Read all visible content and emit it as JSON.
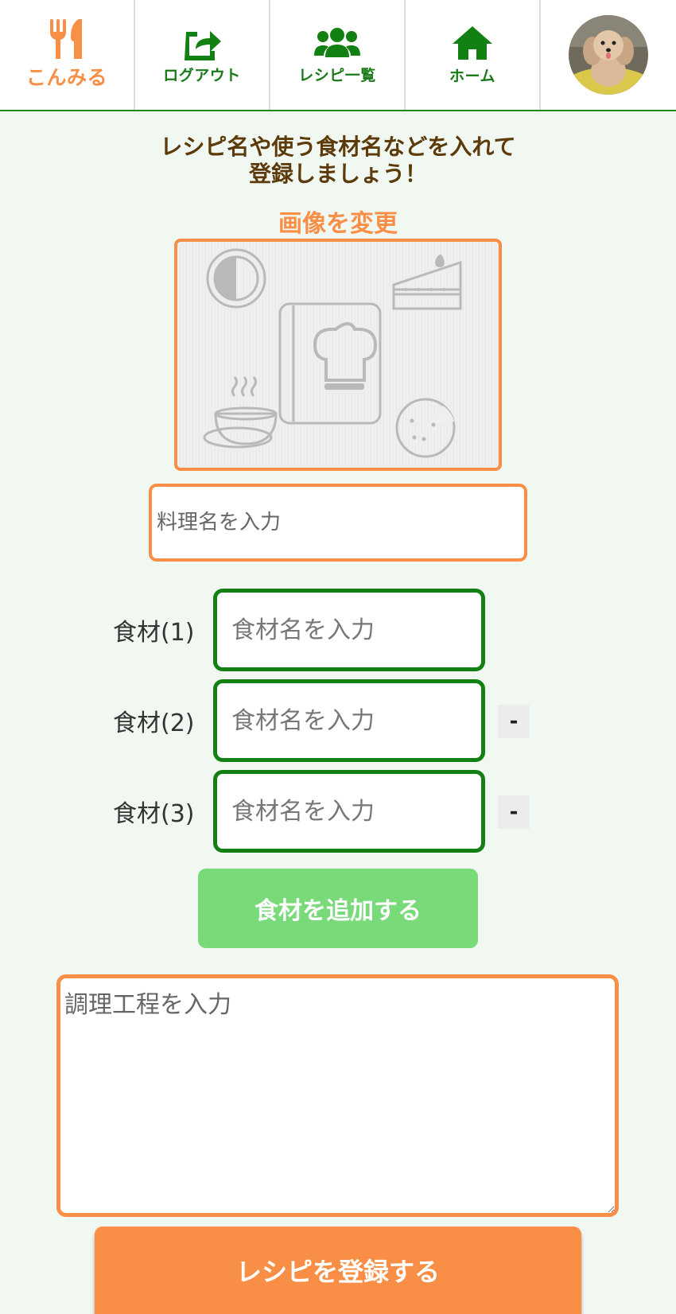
{
  "nav": {
    "brand": "こんみる",
    "logout": "ログアウト",
    "recipes": "レシピ一覧",
    "home": "ホーム"
  },
  "headline": {
    "line1": "レシピ名や使う食材名などを入れて",
    "line2": "登録しましょう！"
  },
  "image": {
    "change_label": "画像を変更"
  },
  "form": {
    "title_placeholder": "料理名を入力",
    "ingredients": [
      {
        "label": "食材(1)",
        "placeholder": "食材名を入力"
      },
      {
        "label": "食材(2)",
        "placeholder": "食材名を入力",
        "remove": "-"
      },
      {
        "label": "食材(3)",
        "placeholder": "食材名を入力",
        "remove": "-"
      }
    ],
    "add_ingredient": "食材を追加する",
    "steps_placeholder": "調理工程を入力",
    "submit": "レシピを登録する"
  },
  "colors": {
    "accent_orange": "#f98f47",
    "brand_green": "#138013",
    "light_green": "#78da78",
    "background": "#f1f8f1"
  },
  "icons": [
    "fork-knife-icon",
    "logout-icon",
    "users-icon",
    "home-icon"
  ]
}
